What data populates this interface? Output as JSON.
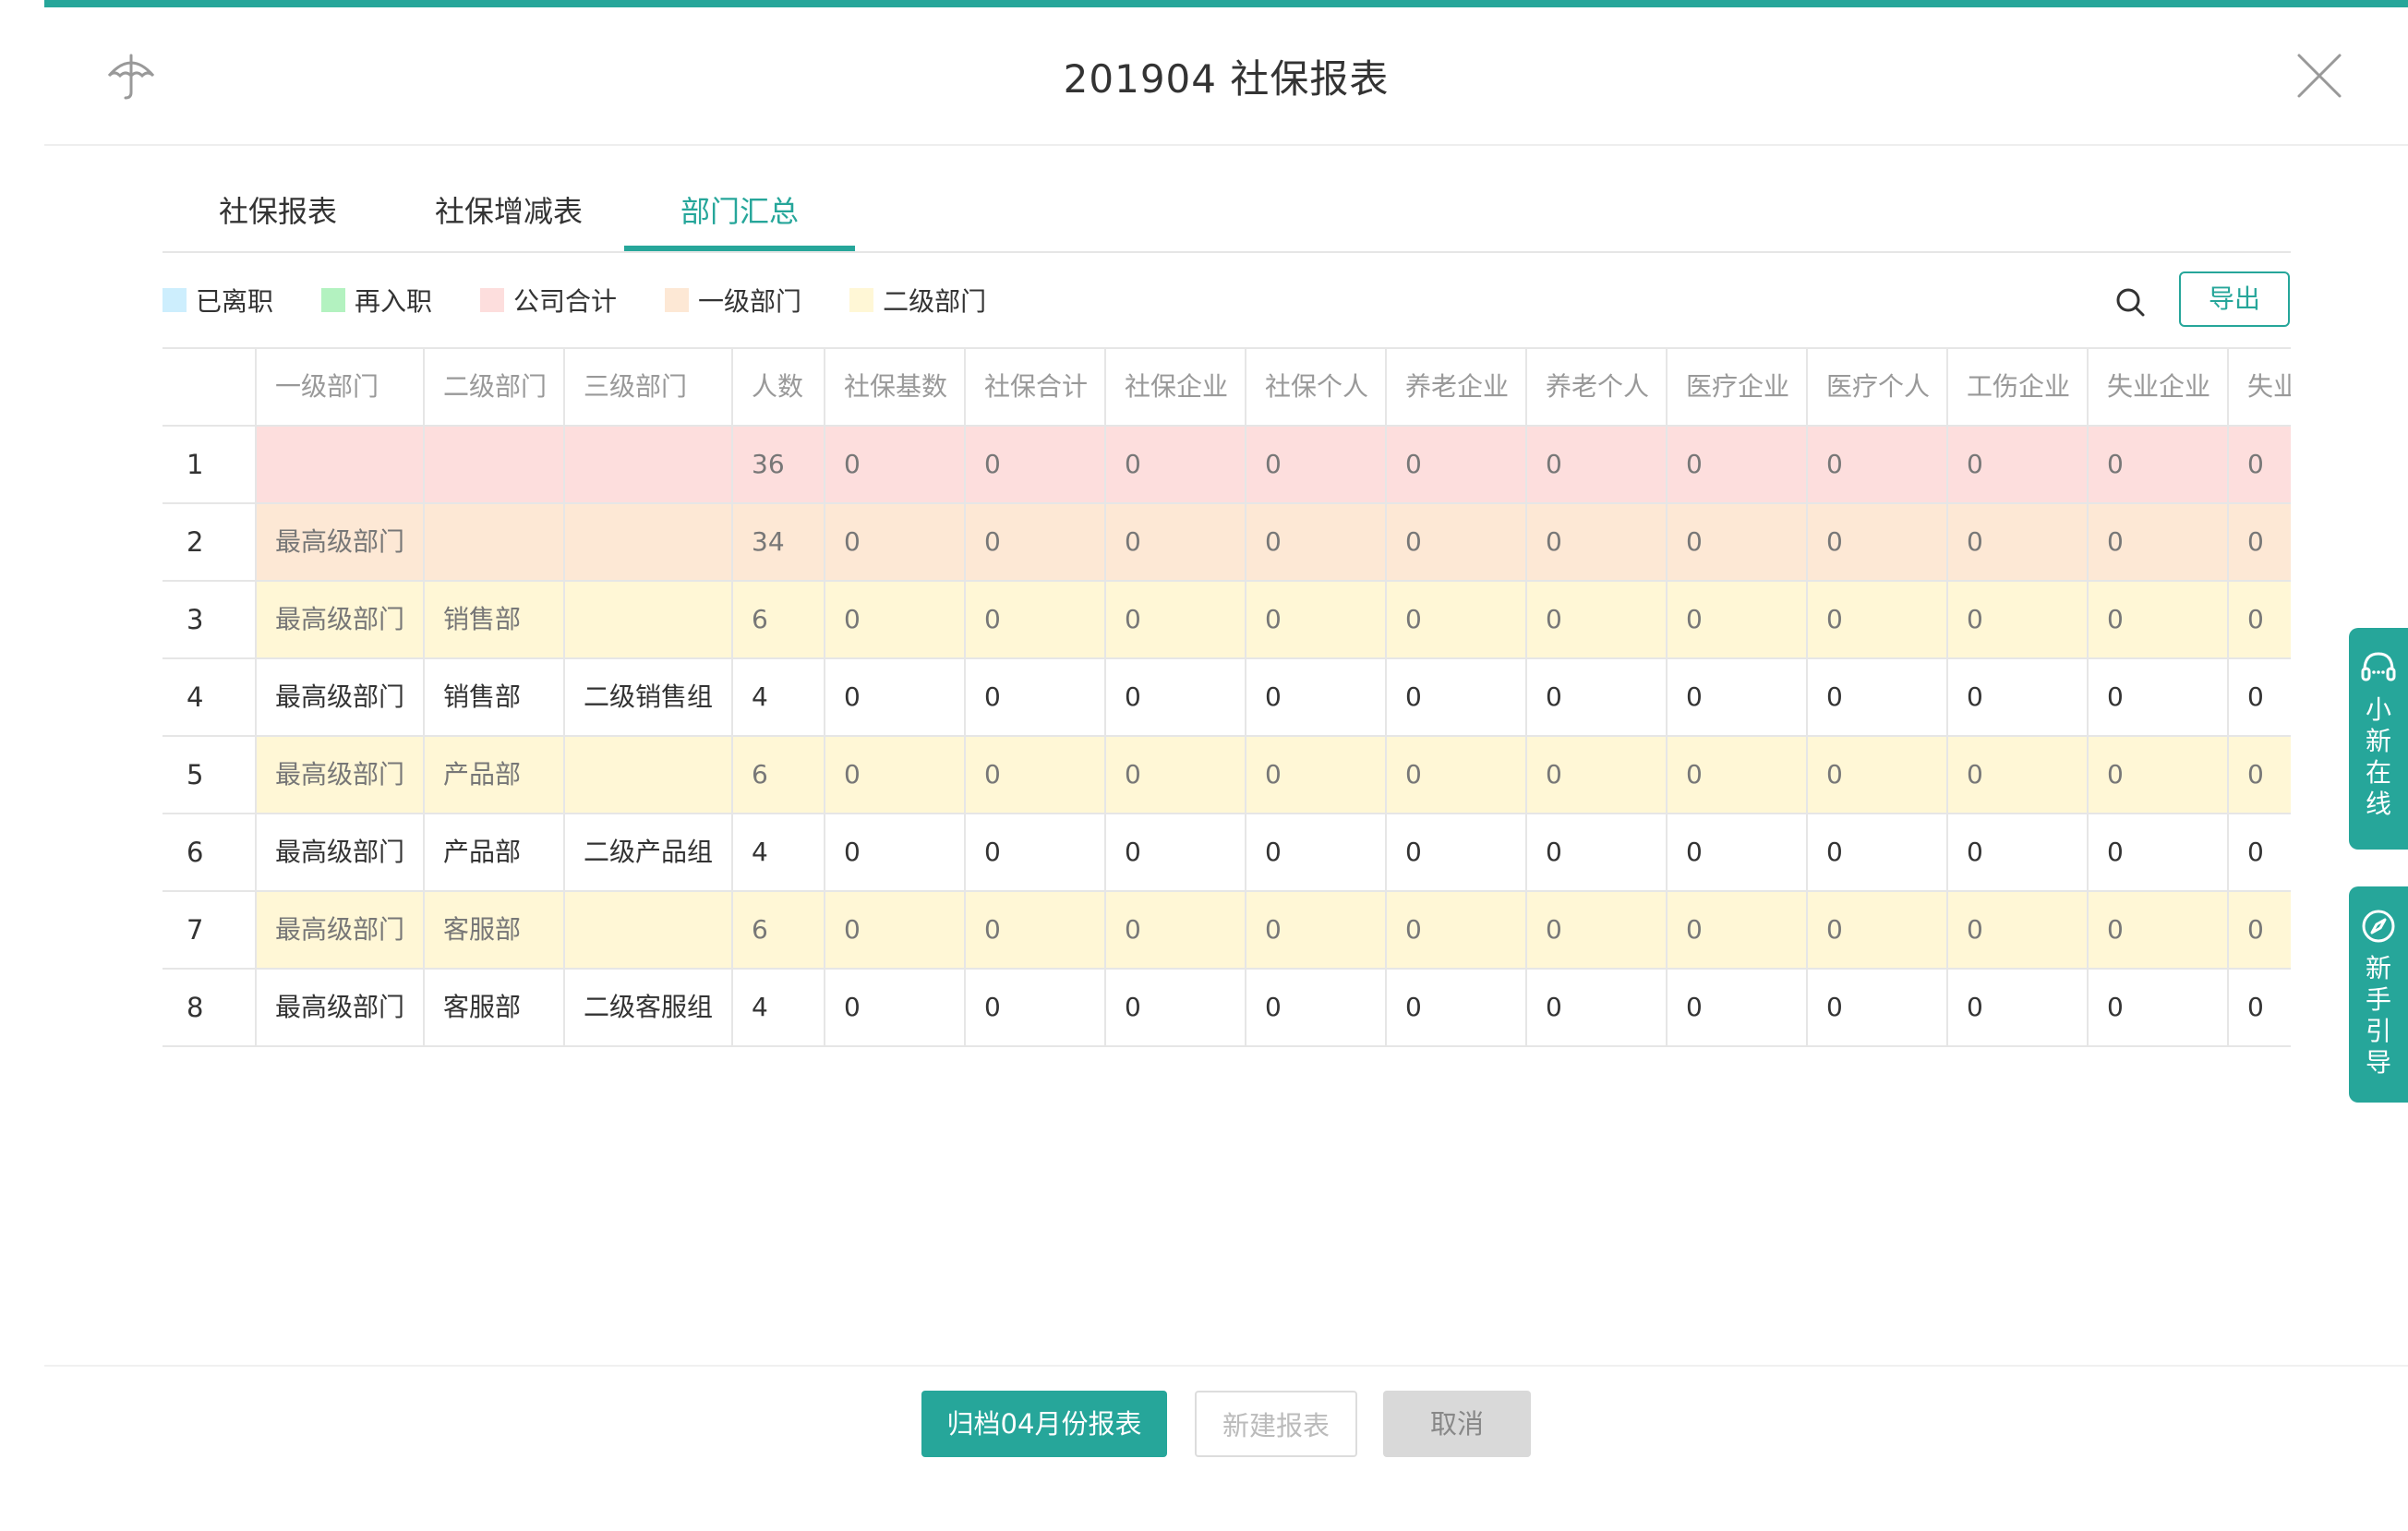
{
  "colors": {
    "accent": "#26a69a",
    "lightpink": "#fddedd",
    "peach": "#fde8d5",
    "lightyellow": "#fff7d6"
  },
  "header": {
    "title": "201904 社保报表",
    "icon": "umbrella-icon",
    "close_icon": "close-icon"
  },
  "tabs": [
    {
      "label": "社保报表"
    },
    {
      "label": "社保增减表"
    },
    {
      "label": "部门汇总",
      "active": true
    }
  ],
  "legend": [
    {
      "label": "已离职",
      "color": "#cdeefd"
    },
    {
      "label": "再入职",
      "color": "#b3f2c0"
    },
    {
      "label": "公司合计",
      "color": "#fddedd"
    },
    {
      "label": "一级部门",
      "color": "#fde8d5"
    },
    {
      "label": "二级部门",
      "color": "#fff7d6"
    }
  ],
  "toolbar": {
    "search_icon": "search-icon",
    "export_label": "导出"
  },
  "table": {
    "headers": [
      "",
      "一级部门",
      "二级部门",
      "三级部门",
      "人数",
      "社保基数",
      "社保合计",
      "社保企业",
      "社保个人",
      "养老企业",
      "养老个人",
      "医疗企业",
      "医疗个人",
      "工伤企业",
      "失业企业",
      "失业"
    ],
    "rows": [
      {
        "type": "pink",
        "cells": [
          "1",
          "",
          "",
          "",
          "36",
          "0",
          "0",
          "0",
          "0",
          "0",
          "0",
          "0",
          "0",
          "0",
          "0",
          "0"
        ]
      },
      {
        "type": "peach",
        "cells": [
          "2",
          "最高级部门",
          "",
          "",
          "34",
          "0",
          "0",
          "0",
          "0",
          "0",
          "0",
          "0",
          "0",
          "0",
          "0",
          "0"
        ]
      },
      {
        "type": "yellow",
        "cells": [
          "3",
          "最高级部门",
          "销售部",
          "",
          "6",
          "0",
          "0",
          "0",
          "0",
          "0",
          "0",
          "0",
          "0",
          "0",
          "0",
          "0"
        ]
      },
      {
        "type": "white",
        "cells": [
          "4",
          "最高级部门",
          "销售部",
          "二级销售组",
          "4",
          "0",
          "0",
          "0",
          "0",
          "0",
          "0",
          "0",
          "0",
          "0",
          "0",
          "0"
        ]
      },
      {
        "type": "yellow",
        "cells": [
          "5",
          "最高级部门",
          "产品部",
          "",
          "6",
          "0",
          "0",
          "0",
          "0",
          "0",
          "0",
          "0",
          "0",
          "0",
          "0",
          "0"
        ]
      },
      {
        "type": "white",
        "cells": [
          "6",
          "最高级部门",
          "产品部",
          "二级产品组",
          "4",
          "0",
          "0",
          "0",
          "0",
          "0",
          "0",
          "0",
          "0",
          "0",
          "0",
          "0"
        ]
      },
      {
        "type": "yellow",
        "cells": [
          "7",
          "最高级部门",
          "客服部",
          "",
          "6",
          "0",
          "0",
          "0",
          "0",
          "0",
          "0",
          "0",
          "0",
          "0",
          "0",
          "0"
        ]
      },
      {
        "type": "white",
        "cells": [
          "8",
          "最高级部门",
          "客服部",
          "二级客服组",
          "4",
          "0",
          "0",
          "0",
          "0",
          "0",
          "0",
          "0",
          "0",
          "0",
          "0",
          "0"
        ]
      }
    ]
  },
  "side": [
    {
      "label": "小新在线",
      "icon": "headset-icon"
    },
    {
      "label": "新手引导",
      "icon": "compass-icon"
    }
  ],
  "footer": {
    "archive_label": "归档04月份报表",
    "new_label": "新建报表",
    "cancel_label": "取消"
  }
}
